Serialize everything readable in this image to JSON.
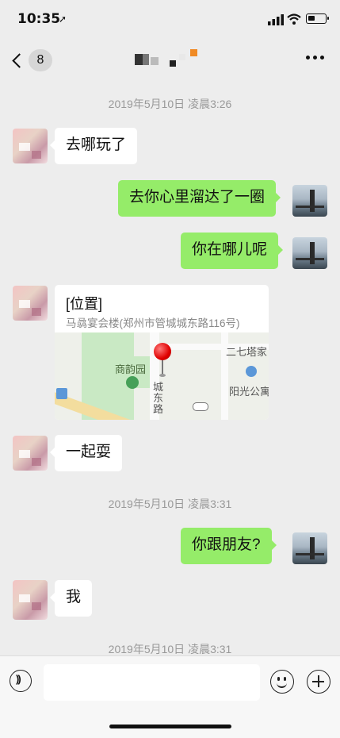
{
  "status": {
    "time": "10:35",
    "arrow": "➚"
  },
  "nav": {
    "back_count": "8"
  },
  "timestamps": [
    "2019年5月10日 凌晨3:26",
    "2019年5月10日 凌晨3:31",
    "2019年5月10日 凌晨3:31"
  ],
  "messages": [
    {
      "side": "left",
      "text": "去哪玩了"
    },
    {
      "side": "right",
      "text": "去你心里溜达了一圈"
    },
    {
      "side": "right",
      "text": "你在哪儿呢"
    },
    {
      "side": "left",
      "text": "一起耍"
    },
    {
      "side": "right",
      "text": "你跟朋友?"
    },
    {
      "side": "left",
      "text": "我"
    }
  ],
  "location": {
    "title": "[位置]",
    "address": "马骉宴会楼(郑州市管城城东路116号)",
    "map_labels": {
      "park": "商韵园",
      "pagoda": "二七塔家",
      "apt": "阳光公寓",
      "road": "城东路"
    }
  },
  "colors": {
    "sent_bubble": "#95ec69",
    "received_bubble": "#ffffff",
    "background": "#ededed"
  }
}
